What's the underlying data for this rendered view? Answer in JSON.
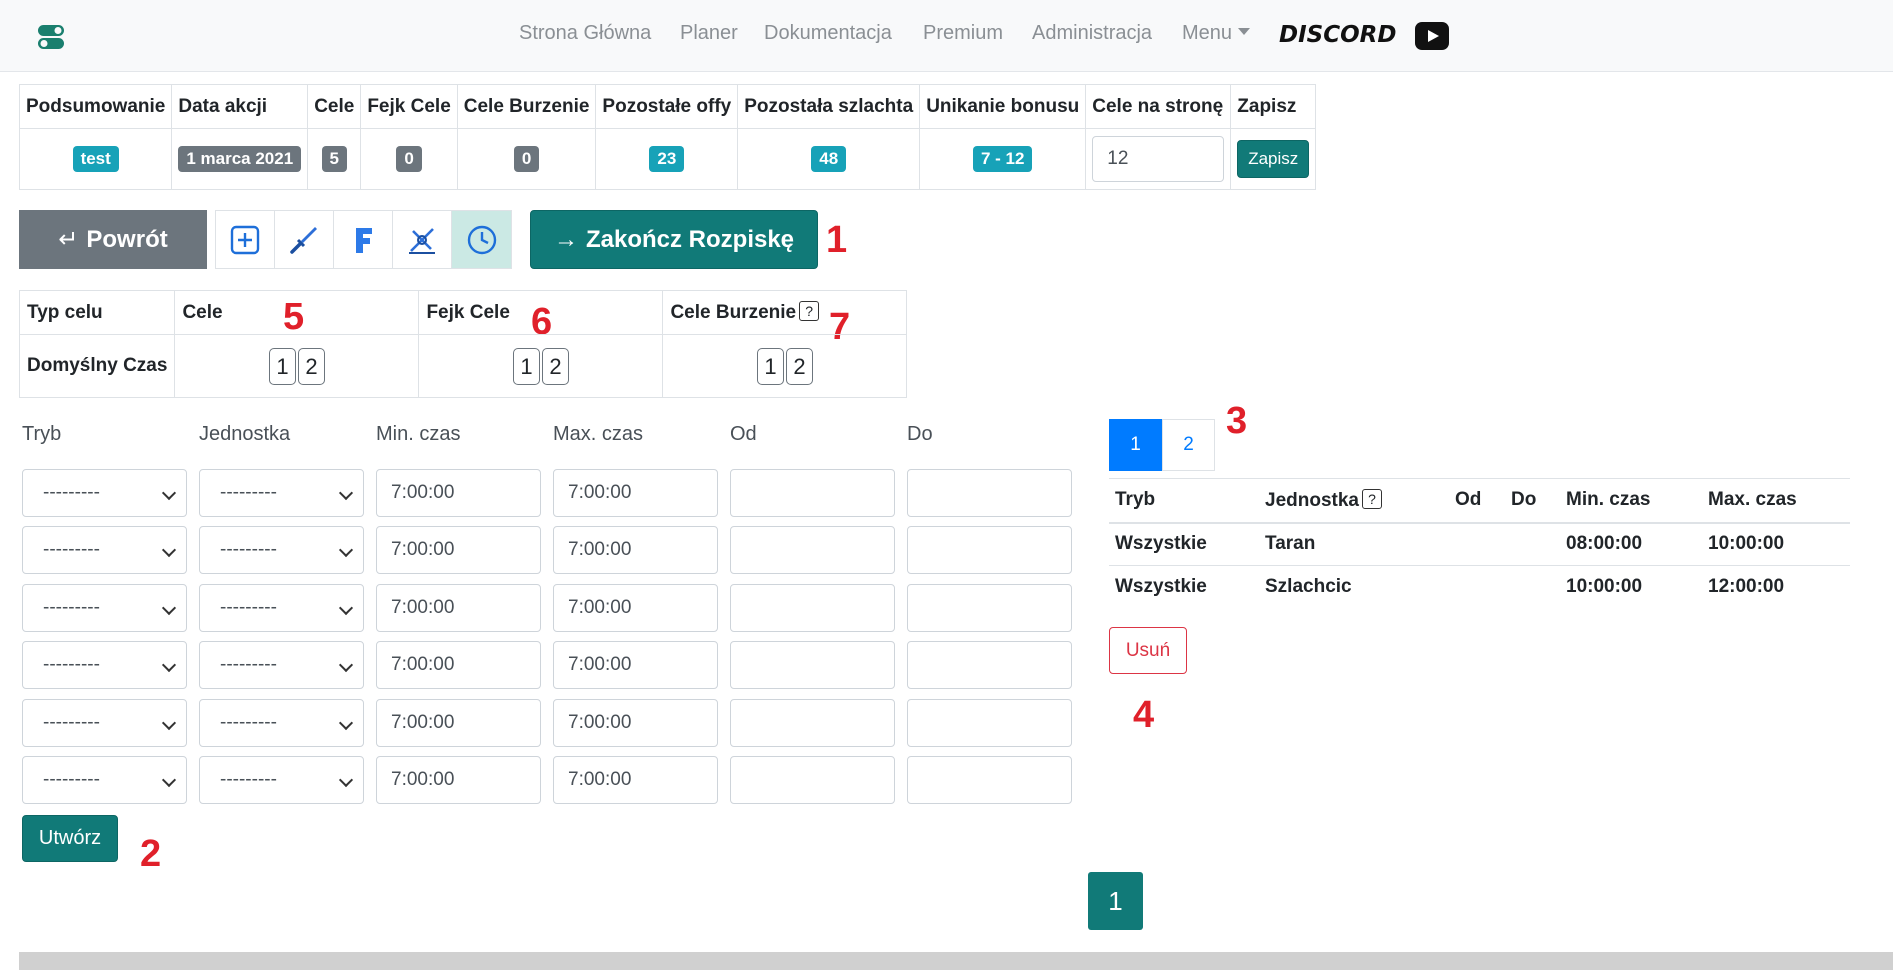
{
  "nav": {
    "links": [
      "Strona Główna",
      "Planer",
      "Dokumentacja",
      "Premium",
      "Administracja"
    ],
    "menu_label": "Menu",
    "discord_label": "DISCORD",
    "youtube_icon": "youtube-icon"
  },
  "summary": {
    "headers": [
      "Podsumowanie",
      "Data akcji",
      "Cele",
      "Fejk Cele",
      "Cele Burzenie",
      "Pozostałe offy",
      "Pozostała szlachta",
      "Unikanie bonusu",
      "Cele na stronę",
      "Zapisz"
    ],
    "values": {
      "podsumowanie": "test",
      "data_akcji": "1 marca 2021",
      "cele": "5",
      "fejk_cele": "0",
      "cele_burzenie": "0",
      "pozostale_offy": "23",
      "pozostala_szlachta": "48",
      "unikanie_bonusu": "7 - 12",
      "cele_na_strone": "12"
    },
    "save_label": "Zapisz"
  },
  "actions": {
    "back_label": "Powrót",
    "back_glyph": "↵",
    "finish_label": "Zakończ Rozpiskę",
    "finish_glyph": "→",
    "tool_icons": [
      "plus-square-icon",
      "sword-icon",
      "fake-f-icon",
      "demolish-icon",
      "clock-icon"
    ]
  },
  "markers": [
    "1",
    "2",
    "3",
    "4",
    "5",
    "6",
    "7"
  ],
  "type_table": {
    "headers": [
      "Typ celu",
      "Cele",
      "Fejk Cele",
      "Cele Burzenie"
    ],
    "help": "?",
    "row_label": "Domyślny Czas",
    "options": [
      "1",
      "2"
    ]
  },
  "form": {
    "labels": [
      "Tryb",
      "Jednostka",
      "Min. czas",
      "Max. czas",
      "Od",
      "Do"
    ],
    "select_placeholder": "---------",
    "rows": [
      {
        "min": "7:00:00",
        "max": "7:00:00"
      },
      {
        "min": "7:00:00",
        "max": "7:00:00"
      },
      {
        "min": "7:00:00",
        "max": "7:00:00"
      },
      {
        "min": "7:00:00",
        "max": "7:00:00"
      },
      {
        "min": "7:00:00",
        "max": "7:00:00"
      },
      {
        "min": "7:00:00",
        "max": "7:00:00"
      }
    ],
    "create_label": "Utwórz"
  },
  "right": {
    "pages": [
      "1",
      "2"
    ],
    "headers": [
      "Tryb",
      "Jednostka",
      "Od",
      "Do",
      "Min. czas",
      "Max. czas"
    ],
    "help": "?",
    "rows": [
      {
        "tryb": "Wszystkie",
        "jednostka": "Taran",
        "od": "",
        "do": "",
        "min": "08:00:00",
        "max": "10:00:00"
      },
      {
        "tryb": "Wszystkie",
        "jednostka": "Szlachcic",
        "od": "",
        "do": "",
        "min": "10:00:00",
        "max": "12:00:00"
      }
    ],
    "delete_label": "Usuń"
  },
  "bottom_pager": {
    "current": "1"
  },
  "colors": {
    "teal": "#117a78",
    "info": "#17a2b8",
    "secondary": "#6c757d",
    "primary": "#007bff",
    "danger": "#dc3545",
    "annotation": "#e0202a"
  }
}
